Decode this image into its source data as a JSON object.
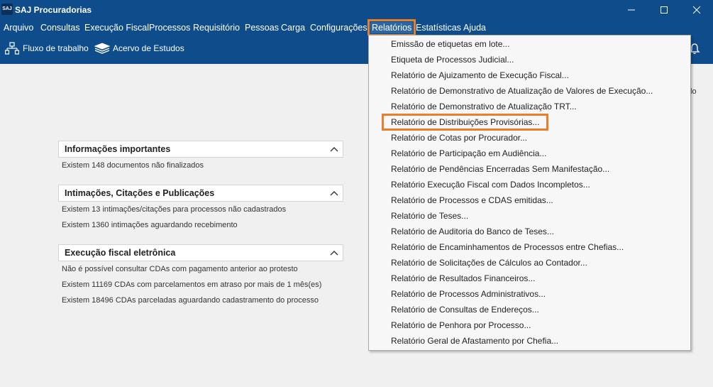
{
  "window": {
    "app_logo": "SAJ",
    "title": "SAJ Procuradorias",
    "controls": [
      "minimize-icon",
      "maximize-icon",
      "close-icon"
    ]
  },
  "menubar": {
    "items": [
      {
        "label": "Arquivo"
      },
      {
        "label": "Consultas"
      },
      {
        "label": "Execução Fiscal"
      },
      {
        "label": "Processos"
      },
      {
        "label": "Requisitório"
      },
      {
        "label": "Pessoas"
      },
      {
        "label": "Carga"
      },
      {
        "label": "Configurações"
      },
      {
        "label": "Relatórios"
      },
      {
        "label": "Estatísticas"
      },
      {
        "label": "Ajuda"
      }
    ],
    "active": "Relatórios"
  },
  "toolbar": {
    "workflow_label": "Fluxo de trabalho",
    "studies_label": "Acervo de Estudos",
    "notification_icon": "bell-icon",
    "partial_right_text": "lo"
  },
  "panels": [
    {
      "title": "Informações importantes",
      "lines": [
        "Existem  148 documentos não finalizados"
      ]
    },
    {
      "title": "Intimações, Citações e Publicações",
      "lines": [
        "Existem  13 intimações/citações para processos não cadastrados",
        "Existem  1360 intimações aguardando recebimento"
      ]
    },
    {
      "title": "Execução fiscal eletrônica",
      "lines": [
        "Não é possível consultar CDAs com pagamento anterior ao protesto",
        "Existem  11169 CDAs com parcelamentos em atraso por mais de 1 mês(es)",
        "Existem  18496 CDAs parceladas aguardando cadastramento do processo"
      ]
    }
  ],
  "reports_menu": {
    "highlighted": "Relatório de Distribuições Provisórias...",
    "items": [
      "Emissão de etiquetas em lote...",
      "Etiqueta de Processos Judicial...",
      "Relatório de Ajuizamento de Execução Fiscal...",
      "Relatório de Demonstrativo de Atualização de Valores de Execução...",
      "Relatório de Demonstrativo de Atualização TRT...",
      "Relatório de Distribuições Provisórias...",
      "Relatório de Cotas por Procurador...",
      "Relatório de Participação em Audiência...",
      "Relatório de Pendências Encerradas Sem Manifestação...",
      "Relatório Execução Fiscal com Dados Incompletos...",
      "Relatório de Processos e CDAS emitidas...",
      "Relatório de Teses...",
      "Relatório de Auditoria do Banco de Teses...",
      "Relatório de Encaminhamentos de Processos entre Chefias...",
      "Relatório de Solicitações de Cálculos ao Contador...",
      "Relatório de Resultados Financeiros...",
      "Relatório de Processos Administrativos...",
      "Relatório de Consultas de Endereços...",
      "Relatório de Penhora por Processo...",
      "Relatório Geral de Afastamento por Chefia..."
    ]
  },
  "colors": {
    "header_bg": "#0f4c8c",
    "highlight_outline": "#e7802e",
    "body_bg": "#f0f0f0"
  }
}
